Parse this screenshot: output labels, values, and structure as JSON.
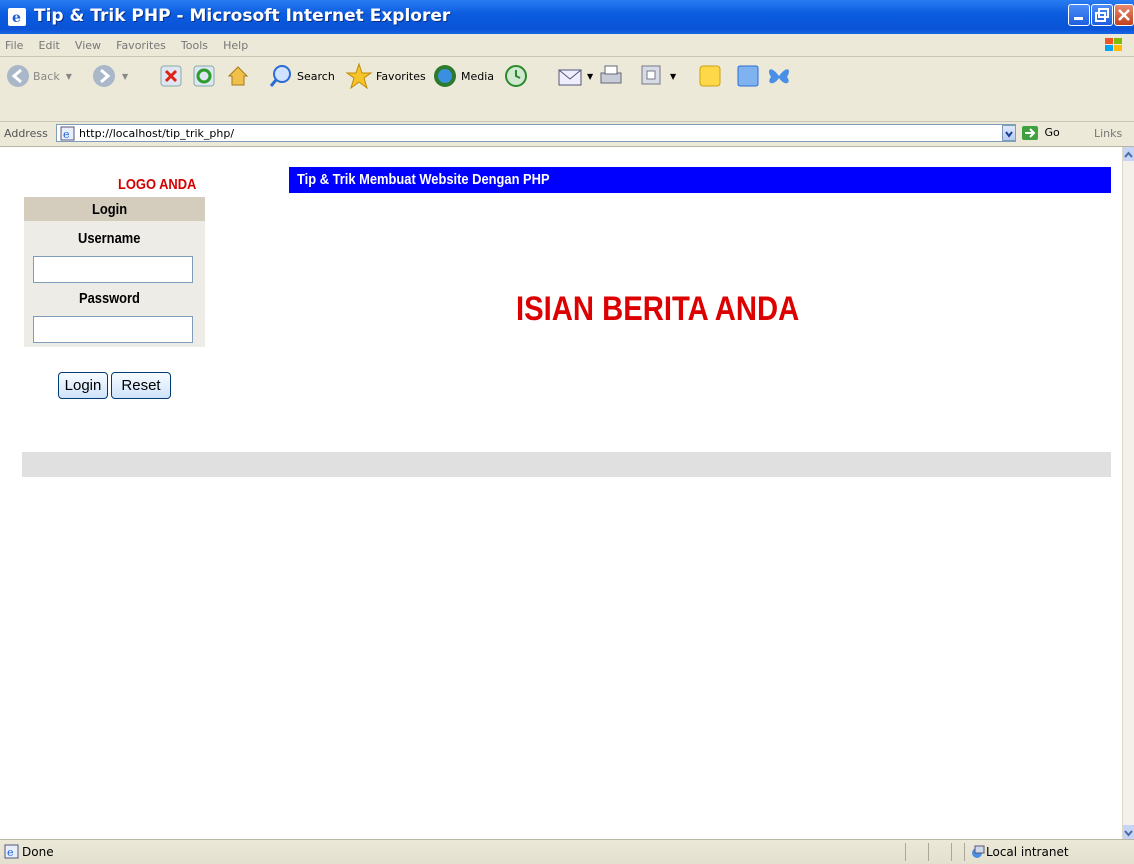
{
  "window": {
    "title": "Tip & Trik PHP - Microsoft Internet Explorer"
  },
  "menu": [
    "File",
    "Edit",
    "View",
    "Favorites",
    "Tools",
    "Help"
  ],
  "toolbar": {
    "back": "Back",
    "search": "Search",
    "favorites": "Favorites",
    "media": "Media"
  },
  "address": {
    "label": "Address",
    "url": "http://localhost/tip_trik_php/",
    "go": "Go",
    "links": "Links"
  },
  "page": {
    "logo": "LOGO ANDA",
    "banner": "Tip & Trik Membuat Website Dengan PHP",
    "headline": "ISIAN BERITA ANDA",
    "login": {
      "header": "Login",
      "username_label": "Username",
      "password_label": "Password",
      "username_value": "",
      "password_value": "",
      "login_button": "Login",
      "reset_button": "Reset"
    }
  },
  "status": {
    "text": "Done",
    "zone": "Local intranet"
  },
  "colors": {
    "banner": "#0000ff",
    "headline": "#dc0000",
    "logo": "#d40000",
    "login_header": "#d4ccbc",
    "login_panel": "#eeece6",
    "footer_bar": "#e0e0e0"
  }
}
